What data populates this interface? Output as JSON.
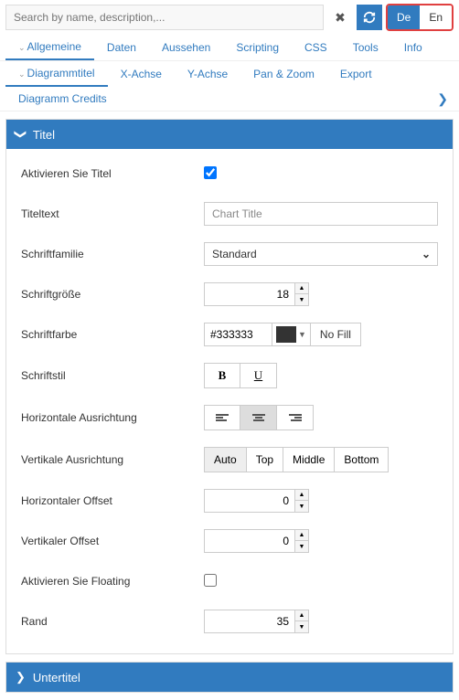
{
  "search": {
    "placeholder": "Search by name, description,..."
  },
  "lang": {
    "de": "De",
    "en": "En"
  },
  "tabsPrimary": [
    "Allgemeine",
    "Daten",
    "Aussehen",
    "Scripting",
    "CSS",
    "Tools",
    "Info"
  ],
  "tabsSecondary": [
    "Diagrammtitel",
    "X-Achse",
    "Y-Achse",
    "Pan & Zoom",
    "Export",
    "Diagramm Credits"
  ],
  "panel": {
    "titel": "Titel",
    "untertitel": "Untertitel"
  },
  "labels": {
    "aktivieren": "Aktivieren Sie Titel",
    "titeltext": "Titeltext",
    "schriftfamilie": "Schriftfamilie",
    "schriftgroesse": "Schriftgröße",
    "schriftfarbe": "Schriftfarbe",
    "schriftstil": "Schriftstil",
    "hAlign": "Horizontale Ausrichtung",
    "vAlign": "Vertikale Ausrichtung",
    "hOffset": "Horizontaler Offset",
    "vOffset": "Vertikaler Offset",
    "floating": "Aktivieren Sie Floating",
    "rand": "Rand"
  },
  "values": {
    "titeltext": "Chart Title",
    "schriftfamilie": "Standard",
    "schriftgroesse": "18",
    "schriftfarbe": "#333333",
    "schriftfarbe_swatch": "#333333",
    "nofill": "No Fill",
    "bold": "B",
    "underline": "U",
    "vAlign": {
      "auto": "Auto",
      "top": "Top",
      "middle": "Middle",
      "bottom": "Bottom"
    },
    "hOffset": "0",
    "vOffset": "0",
    "rand": "35",
    "aktivieren_checked": true,
    "floating_checked": false
  }
}
